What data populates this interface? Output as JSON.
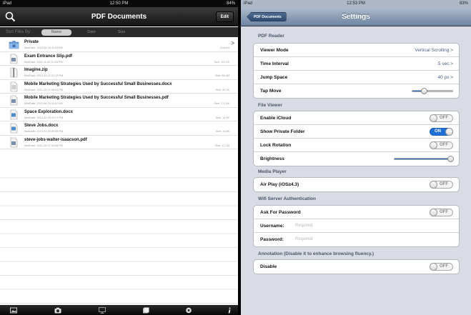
{
  "left": {
    "status": {
      "carrier": "iPad",
      "time": "12:50 PM",
      "battery": "84%"
    },
    "nav": {
      "title": "PDF Documents",
      "edit_label": "Edit"
    },
    "sort": {
      "label": "Sort Files By:",
      "options": [
        "Name",
        "Date",
        "Size"
      ],
      "selected": "Name"
    },
    "files": [
      {
        "name": "Private",
        "date": "ModDate: 2012-06-15 11:43 AM",
        "size": "Count:0",
        "icon": "folder-icon",
        "chevron": ">"
      },
      {
        "name": "Exam Entrance Slip.pdf",
        "date": "ModDate: 2011-11-02 10:03 PM",
        "size": "Size: 101.2K",
        "icon": "pdf-file-icon"
      },
      {
        "name": "Imagine.zip",
        "date": "ModDate: 2012-02-21 01:13 PM",
        "size": "Size: 86.4M",
        "icon": "zip-file-icon"
      },
      {
        "name": "Mobile Marketing Strategies Used by Successful Small Businesses.docx",
        "date": "ModDate: 2011-10-24 08:04 PM",
        "size": "Size: 92.2K",
        "icon": "docx-file-icon"
      },
      {
        "name": "Mobile Marketing Strategies Used by Successful Small Businesses.pdf",
        "date": "ModDate: 2012-06-15 11:02 AM",
        "size": "Size: 171.4K",
        "icon": "pdf-file-icon"
      },
      {
        "name": "Space Exploration.docx",
        "date": "ModDate: 2012-02-03 10:27 PM",
        "size": "Size: 14.3K",
        "icon": "docx-file-icon"
      },
      {
        "name": "Steve Jobs.docx",
        "date": "ModDate: 2012-02-20 09:58 PM",
        "size": "Size: 14.8K",
        "icon": "docx-file-icon"
      },
      {
        "name": "steve-jobs-walter-isaacson.pdf",
        "date": "ModDate: 2011-10-27 02:08 PM",
        "size": "Size: 12.1M",
        "icon": "pdf-file-icon"
      }
    ],
    "tabs": [
      "photo-icon",
      "camera-icon",
      "monitor-icon",
      "files-icon",
      "settings-icon",
      "info-icon"
    ]
  },
  "right": {
    "status": {
      "carrier": "iPad",
      "time": "12:53 PM",
      "battery": "83%"
    },
    "nav": {
      "title": "Settings",
      "back_label": "PDF Documents"
    },
    "sections": {
      "pdf_reader": {
        "header": "PDF Reader",
        "viewer_mode": {
          "label": "Viewer Mode",
          "value": "Vertical Scrolling >"
        },
        "time_interval": {
          "label": "Time Interval",
          "value": "5 sec >"
        },
        "jump_space": {
          "label": "Jump Space",
          "value": "40 px >"
        },
        "tap_move": {
          "label": "Tap Move",
          "level": 0.3
        }
      },
      "file_viewer": {
        "header": "File Viewer",
        "enable_icloud": {
          "label": "Enable iCloud",
          "state": "OFF"
        },
        "show_private": {
          "label": "Show Private Folder",
          "state": "ON"
        },
        "lock_rotation": {
          "label": "Lock Rotation",
          "state": "OFF"
        },
        "brightness": {
          "label": "Brightness",
          "level": 1.0
        }
      },
      "media_player": {
        "header": "Media Player",
        "air_play": {
          "label": "Air Play (iOS≥4.3)",
          "state": "OFF"
        }
      },
      "wifi": {
        "header": "Wifi Server Authentication",
        "ask_password": {
          "label": "Ask For Password",
          "state": "OFF"
        },
        "username": {
          "label": "Username:",
          "placeholder": "Required"
        },
        "password": {
          "label": "Password:",
          "placeholder": "Required"
        }
      },
      "annotation": {
        "header": "Annotation (Disable it to enhance browsing fluency.)",
        "disable": {
          "label": "Disable",
          "state": "OFF"
        }
      }
    }
  }
}
